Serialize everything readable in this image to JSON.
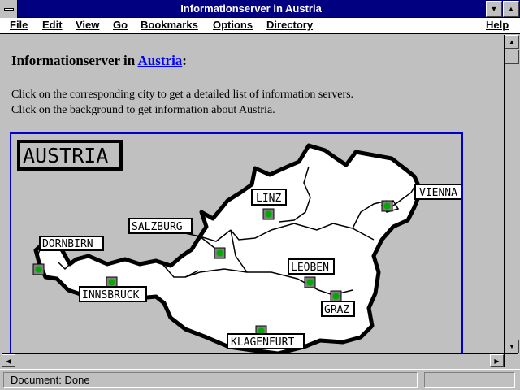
{
  "window": {
    "title": "Informationserver in Austria"
  },
  "menu": {
    "file": "File",
    "edit": "Edit",
    "view": "View",
    "go": "Go",
    "bookmarks": "Bookmarks",
    "options": "Options",
    "directory": "Directory",
    "help": "Help"
  },
  "page": {
    "heading_prefix": "Informationserver in ",
    "heading_link": "Austria",
    "heading_suffix": ":",
    "line1": "Click on the corresponding city to get a detailed list of information servers.",
    "line2": "Click on the background to get information about Austria."
  },
  "map": {
    "title": "AUSTRIA",
    "cities": {
      "vienna": "VIENNA",
      "linz": "LINZ",
      "salzburg": "SALZBURG",
      "dornbirn": "DORNBIRN",
      "innsbruck": "INNSBRUCK",
      "leoben": "LEOBEN",
      "graz": "GRAZ",
      "klagenfurt": "KLAGENFURT"
    }
  },
  "status": {
    "text": "Document: Done"
  },
  "colors": {
    "titlebar": "#000080",
    "link": "#0000ff",
    "map_border": "#0000cc",
    "marker": "#00aa00"
  }
}
